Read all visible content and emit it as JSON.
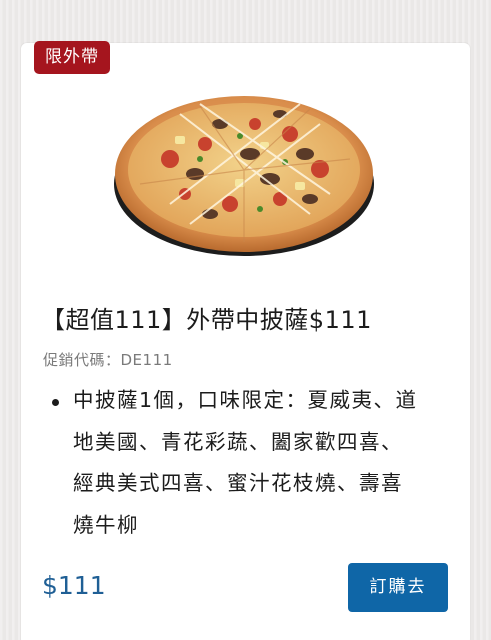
{
  "card": {
    "badge": "限外帶",
    "title": "【超值111】外帶中披薩$111",
    "promo_code": "促銷代碼：DE111",
    "description_lines": [
      "中披薩1個，口味限定：夏威夷、道",
      "地美國、青花彩蔬、闔家歡四喜、",
      "經典美式四喜、蜜汁花枝燒、壽喜",
      "燒牛柳"
    ],
    "price": "$111",
    "order_button": "訂購去"
  },
  "colors": {
    "badge": "#a5151e",
    "price": "#1f5f95",
    "button": "#0f66a7"
  }
}
